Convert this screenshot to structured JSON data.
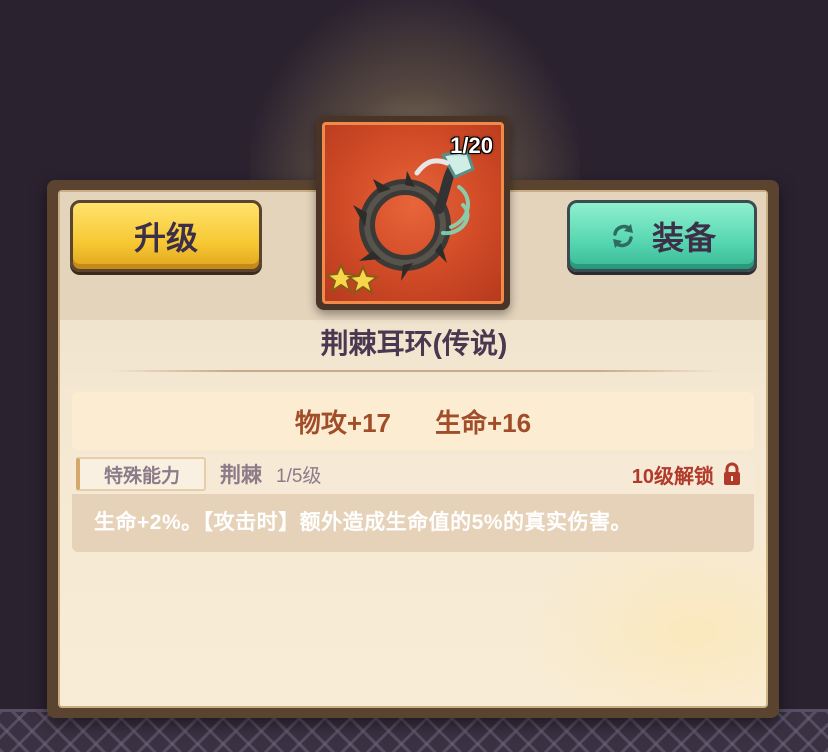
{
  "item": {
    "name": "荆棘耳环(传说)",
    "count": "1/20",
    "stars": 2
  },
  "buttons": {
    "upgrade_label": "升级",
    "equip_label": "装备",
    "equip_icon": "refresh-icon"
  },
  "stats": [
    {
      "label": "物攻+17"
    },
    {
      "label": "生命+16"
    }
  ],
  "ability": {
    "tag": "特殊能力",
    "name": "荆棘",
    "level": "1/5级",
    "unlock_text": "10级解锁",
    "lock_icon": "lock-icon",
    "description": "生命+2%。【攻击时】额外造成生命值的5%的真实伤害。"
  },
  "colors": {
    "upgrade_button": "#f7c834",
    "equip_button": "#56d6b0",
    "item_background": "#d04a26",
    "stat_text": "#a24d2a",
    "unlock_text": "#b23a2a"
  }
}
